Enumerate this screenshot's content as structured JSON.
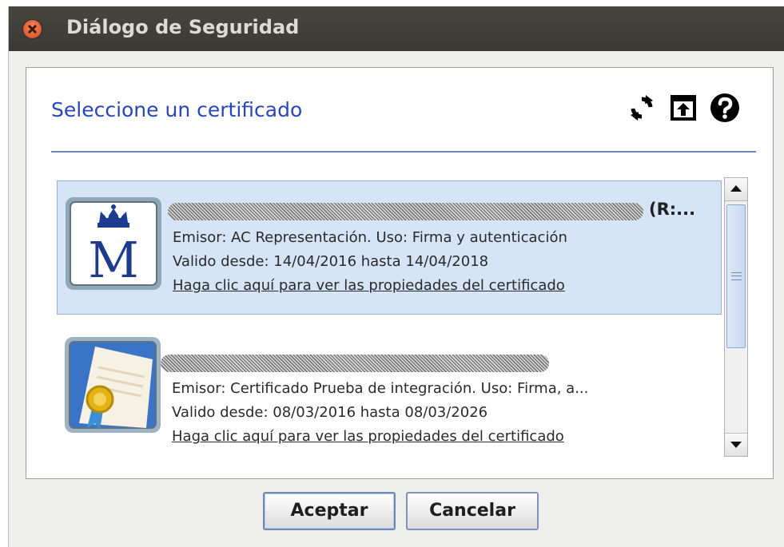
{
  "window": {
    "title": "Diálogo de Seguridad"
  },
  "dialog": {
    "heading": "Seleccione un certificado",
    "toolbar": [
      {
        "icon": "refresh-icon"
      },
      {
        "icon": "import-certificate-icon"
      },
      {
        "icon": "help-icon"
      }
    ],
    "certificates": [
      {
        "icon": "fnmt-crown-m-icon",
        "name_suffix": "(R:...",
        "issuer_line": "Emisor: AC Representación. Uso: Firma y autenticación",
        "validity_line": "Valido desde: 14/04/2016 hasta 14/04/2018",
        "link": "Haga clic aquí para ver las propiedades del certificado",
        "selected": true
      },
      {
        "icon": "certificate-seal-icon",
        "name_suffix": "",
        "issuer_line": "Emisor: Certificado Prueba de integración. Uso: Firma, a...",
        "validity_line": "Valido desde: 08/03/2016 hasta 08/03/2026",
        "link": "Haga clic aquí para ver las propiedades del certificado",
        "selected": false
      }
    ]
  },
  "buttons": {
    "accept": "Aceptar",
    "cancel": "Cancelar"
  },
  "colors": {
    "heading": "#2846b8",
    "selection": "#d5e4f6",
    "titlebar": "#3f3e39"
  }
}
